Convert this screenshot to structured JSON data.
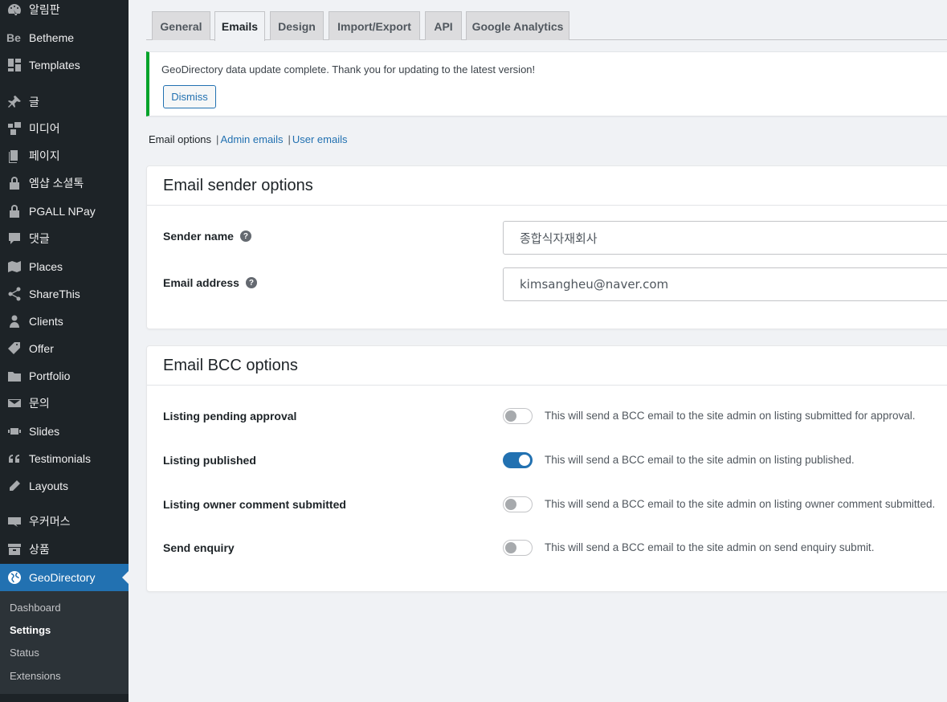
{
  "sidebar": {
    "items": [
      {
        "label": "알림판",
        "icon": "dashboard-icon"
      },
      {
        "label": "Betheme",
        "icon": "betheme-icon"
      },
      {
        "label": "Templates",
        "icon": "templates-icon"
      },
      {
        "label": "글",
        "icon": "pin-icon"
      },
      {
        "label": "미디어",
        "icon": "media-icon"
      },
      {
        "label": "페이지",
        "icon": "page-icon"
      },
      {
        "label": "엠샵 소셜톡",
        "icon": "lock-icon"
      },
      {
        "label": "PGALL NPay",
        "icon": "lock-icon"
      },
      {
        "label": "댓글",
        "icon": "comment-icon"
      },
      {
        "label": "Places",
        "icon": "places-icon"
      },
      {
        "label": "ShareThis",
        "icon": "share-icon"
      },
      {
        "label": "Clients",
        "icon": "user-icon"
      },
      {
        "label": "Offer",
        "icon": "tag-icon"
      },
      {
        "label": "Portfolio",
        "icon": "folder-icon"
      },
      {
        "label": "문의",
        "icon": "mail-icon"
      },
      {
        "label": "Slides",
        "icon": "slides-icon"
      },
      {
        "label": "Testimonials",
        "icon": "quote-icon"
      },
      {
        "label": "Layouts",
        "icon": "pencil-icon"
      },
      {
        "label": "우커머스",
        "icon": "woo-icon"
      },
      {
        "label": "상품",
        "icon": "archive-icon"
      },
      {
        "label": "GeoDirectory",
        "icon": "globe-icon"
      }
    ],
    "submenu": [
      "Dashboard",
      "Settings",
      "Status",
      "Extensions"
    ],
    "current_submenu": "Settings"
  },
  "tabs": [
    "General",
    "Emails",
    "Design",
    "Import/Export",
    "API",
    "Google Analytics"
  ],
  "active_tab": "Emails",
  "notice": {
    "text": "GeoDirectory data update complete. Thank you for updating to the latest version!",
    "dismiss_label": "Dismiss"
  },
  "subnav": {
    "current": "Email options",
    "links": [
      "Admin emails",
      "User emails"
    ],
    "separator": "|"
  },
  "sender_card": {
    "title": "Email sender options",
    "fields": [
      {
        "label": "Sender name",
        "value": "종합식자재회사"
      },
      {
        "label": "Email address",
        "value": "kimsangheu@naver.com"
      }
    ],
    "help_glyph": "?"
  },
  "bcc_card": {
    "title": "Email BCC options",
    "rows": [
      {
        "label": "Listing pending approval",
        "on": false,
        "desc": "This will send a BCC email to the site admin on listing submitted for approval."
      },
      {
        "label": "Listing published",
        "on": true,
        "desc": "This will send a BCC email to the site admin on listing published."
      },
      {
        "label": "Listing owner comment submitted",
        "on": false,
        "desc": "This will send a BCC email to the site admin on listing owner comment submitted."
      },
      {
        "label": "Send enquiry",
        "on": false,
        "desc": "This will send a BCC email to the site admin on send enquiry submit."
      }
    ]
  },
  "colors": {
    "sidebar_bg": "#1d2327",
    "accent": "#2271b1",
    "notice_border": "#00a32a"
  }
}
